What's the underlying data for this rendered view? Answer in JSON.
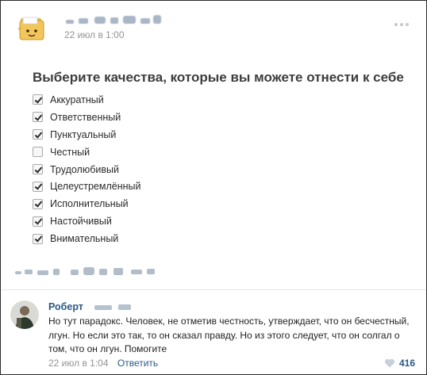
{
  "post": {
    "date": "22 июл в 1:00"
  },
  "poll": {
    "question": "Выберите качества, которые вы можете отнести к себе",
    "items": [
      {
        "label": "Аккуратный",
        "checked": true
      },
      {
        "label": "Ответственный",
        "checked": true
      },
      {
        "label": "Пунктуальный",
        "checked": true
      },
      {
        "label": "Честный",
        "checked": false
      },
      {
        "label": "Трудолюбивый",
        "checked": true
      },
      {
        "label": "Целеустремлённый",
        "checked": true
      },
      {
        "label": "Исполнительный",
        "checked": true
      },
      {
        "label": "Настойчивый",
        "checked": true
      },
      {
        "label": "Внимательный",
        "checked": true
      }
    ]
  },
  "comment": {
    "author": "Роберт",
    "text": "Но тут парадокс. Человек, не отметив честность, утверждает, что он бесчестный, лгун. Но если это так, то он сказал правду. Но из этого следует, что он солгал о том, что он лгун. Помогите",
    "date": "22 июл в 1:04",
    "reply_label": "Ответить",
    "likes": "416"
  },
  "colors": {
    "link": "#2a5885",
    "muted": "#939393"
  },
  "icons": [
    "folder-avatar-icon",
    "more-dots-icon",
    "heart-icon"
  ]
}
